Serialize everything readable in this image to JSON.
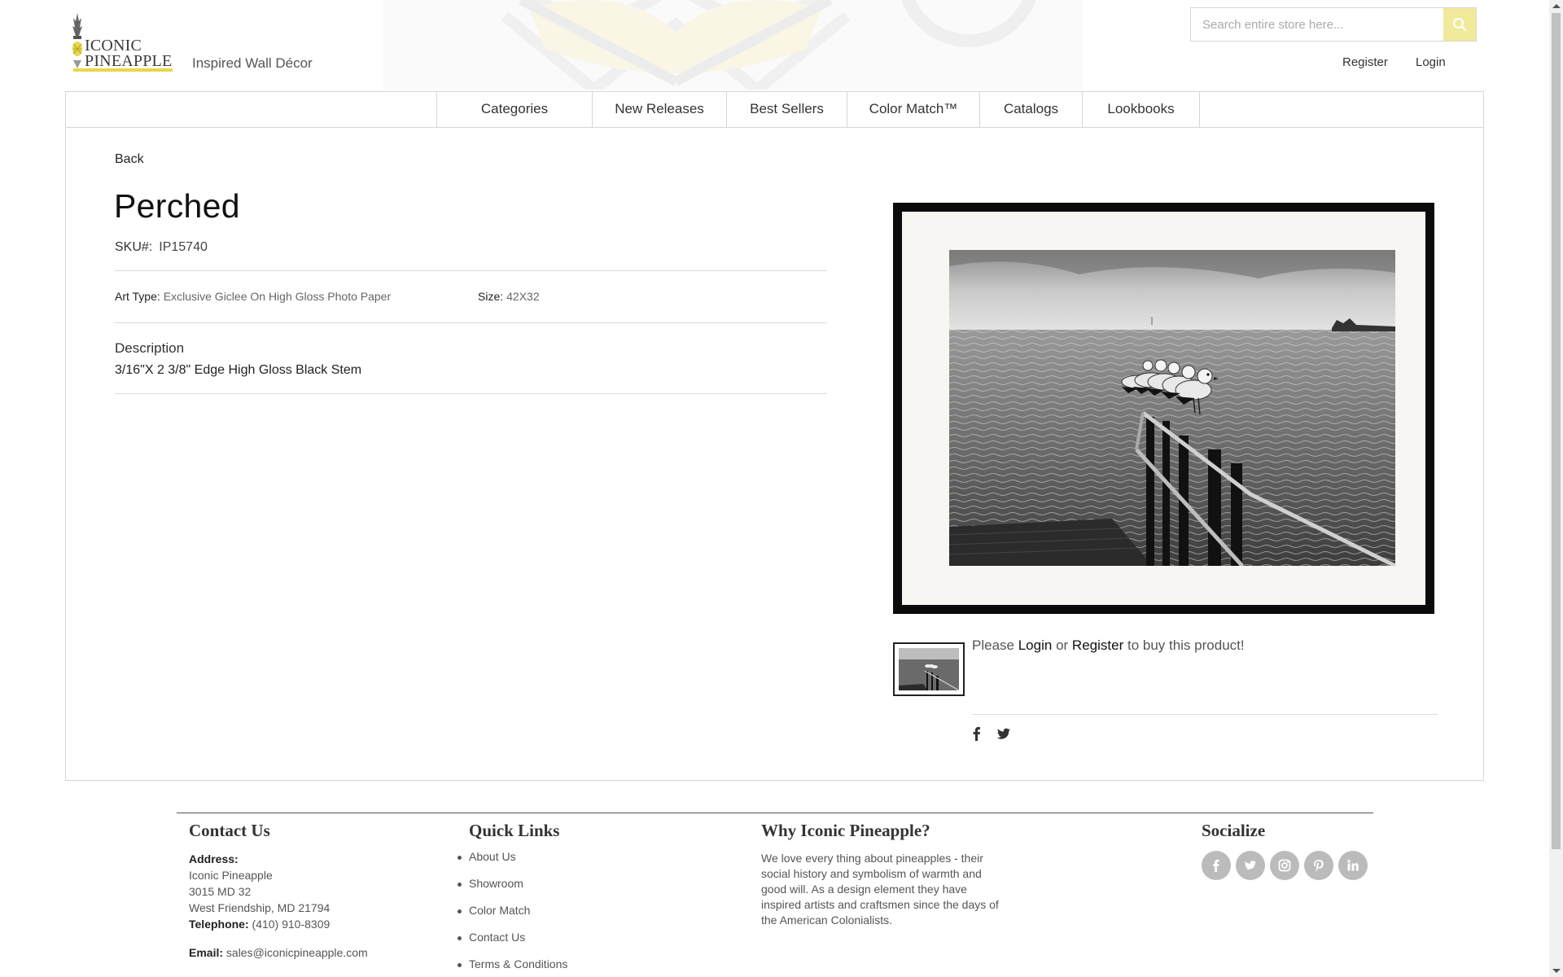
{
  "brand": {
    "logo_line1": "ICONIC",
    "logo_line2": "PINEAPPLE",
    "tagline": "Inspired Wall Décor",
    "accent_color": "#e6d84a"
  },
  "search": {
    "placeholder": "Search entire store here...",
    "icon": "search-icon"
  },
  "account": {
    "register": "Register",
    "login": "Login"
  },
  "nav": {
    "items": [
      {
        "label": "Categories"
      },
      {
        "label": "New Releases"
      },
      {
        "label": "Best Sellers"
      },
      {
        "label": "Color Match™"
      },
      {
        "label": "Catalogs"
      },
      {
        "label": "Lookbooks"
      }
    ]
  },
  "product": {
    "back_label": "Back",
    "title": "Perched",
    "sku_label": "SKU#:",
    "sku": "IP15740",
    "art_type_label": "Art Type:",
    "art_type": "Exclusive Giclee On High Gloss Photo Paper",
    "size_label": "Size:",
    "size": "42X32",
    "description_heading": "Description",
    "description": "3/16\"X 2 3/8\" Edge High Gloss Black Stem",
    "buy_prefix": "Please",
    "buy_login": "Login",
    "buy_or": "or",
    "buy_register": "Register",
    "buy_suffix": "to buy this product!",
    "share_icons": [
      "facebook-icon",
      "twitter-icon"
    ]
  },
  "footer": {
    "contact": {
      "heading": "Contact Us",
      "address_label": "Address:",
      "address_line1": "Iconic Pineapple",
      "address_line2": "3015 MD 32",
      "address_line3": "West Friendship, MD 21794",
      "telephone_label": "Telephone:",
      "telephone": "(410) 910-8309",
      "email_label": "Email:",
      "email": "sales@iconicpineapple.com"
    },
    "quick_links": {
      "heading": "Quick Links",
      "items": [
        "About Us",
        "Showroom",
        "Color Match",
        "Contact Us",
        "Terms & Conditions"
      ]
    },
    "why": {
      "heading": "Why Iconic Pineapple?",
      "line1": "We love every thing about pineapples - their",
      "line2": "social history and symbolism of warmth and",
      "line3": "good will. As a design element they have",
      "line4": "inspired artists and craftsmen since the days of",
      "line5": "the American Colonialists."
    },
    "socialize": {
      "heading": "Socialize",
      "icons": [
        "facebook-icon",
        "twitter-icon",
        "instagram-icon",
        "pinterest-icon",
        "linkedin-icon"
      ]
    }
  }
}
